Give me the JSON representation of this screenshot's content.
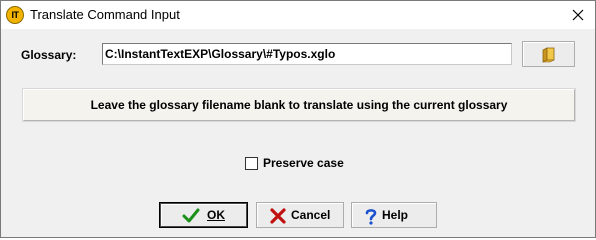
{
  "window": {
    "title": "Translate Command Input",
    "app_icon_text": "IT"
  },
  "glossary": {
    "label": "Glossary:",
    "value": "C:\\InstantTextEXP\\Glossary\\#Typos.xglo"
  },
  "info": {
    "text": "Leave the glossary filename blank to translate using the current glossary"
  },
  "options": {
    "preserve_case_label": "Preserve case",
    "preserve_case_checked": false
  },
  "buttons": {
    "ok": "OK",
    "cancel": "Cancel",
    "help": "Help"
  },
  "colors": {
    "dialog_bg": "#f0f0f0",
    "ok_check": "#1a8f1a",
    "cancel_x": "#c01010",
    "help_q": "#1a4fd0",
    "folder": "#e8b830"
  }
}
